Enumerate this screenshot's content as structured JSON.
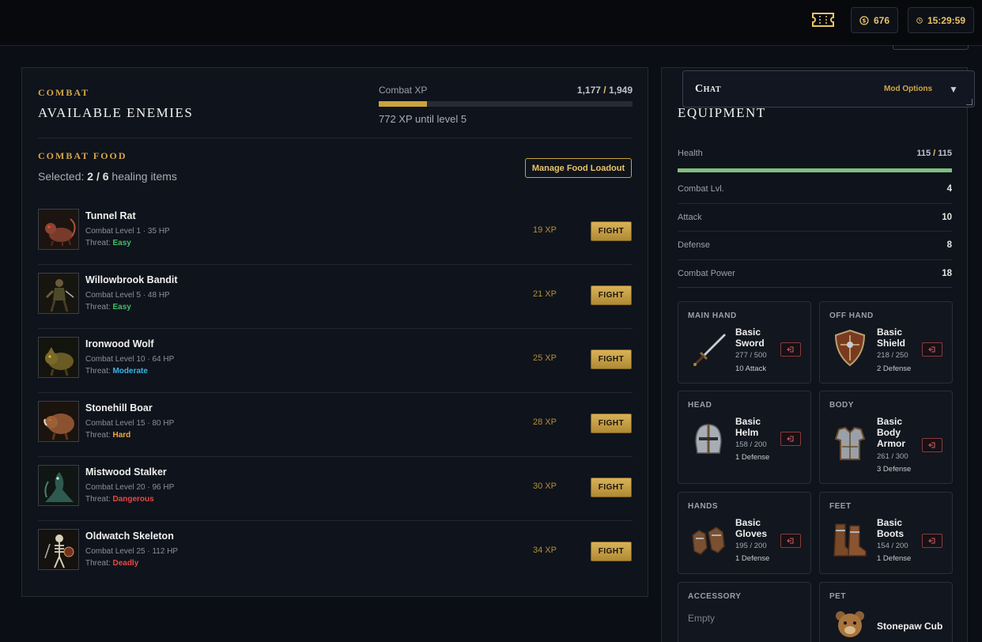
{
  "topbar": {
    "coins": "676",
    "clock": "15:29:59"
  },
  "combat": {
    "kicker": "Combat",
    "title": "Available Enemies",
    "xp_label": "Combat XP",
    "xp_current": "1,177",
    "xp_sep": " / ",
    "xp_max": "1,949",
    "xp_fraction": 0.19,
    "xp_note": "772 XP until level 5"
  },
  "food": {
    "kicker": "Combat Food",
    "selected_prefix": "Selected: ",
    "selected_value": "2 / 6",
    "selected_suffix": " healing items",
    "manage_label": "Manage Food Loadout"
  },
  "enemies": [
    {
      "name": "Tunnel Rat",
      "meta": "Combat Level 1 · 35 HP",
      "threat_label": "Threat: ",
      "threat": "Easy",
      "threat_color": "#3fbf6a",
      "xp": "19 XP",
      "fight": "FIGHT"
    },
    {
      "name": "Willowbrook Bandit",
      "meta": "Combat Level 5 · 48 HP",
      "threat_label": "Threat: ",
      "threat": "Easy",
      "threat_color": "#3fbf6a",
      "xp": "21 XP",
      "fight": "FIGHT"
    },
    {
      "name": "Ironwood Wolf",
      "meta": "Combat Level 10 · 64 HP",
      "threat_label": "Threat: ",
      "threat": "Moderate",
      "threat_color": "#3ab4e6",
      "xp": "25 XP",
      "fight": "FIGHT"
    },
    {
      "name": "Stonehill Boar",
      "meta": "Combat Level 15 · 80 HP",
      "threat_label": "Threat: ",
      "threat": "Hard",
      "threat_color": "#f0a93a",
      "xp": "28 XP",
      "fight": "FIGHT"
    },
    {
      "name": "Mistwood Stalker",
      "meta": "Combat Level 20 · 96 HP",
      "threat_label": "Threat: ",
      "threat": "Dangerous",
      "threat_color": "#e64848",
      "xp": "30 XP",
      "fight": "FIGHT"
    },
    {
      "name": "Oldwatch Skeleton",
      "meta": "Combat Level 25 · 112 HP",
      "threat_label": "Threat: ",
      "threat": "Deadly",
      "threat_color": "#e64848",
      "xp": "34 XP",
      "fight": "FIGHT"
    }
  ],
  "equipment": {
    "title": "Equipment",
    "health_label": "Health",
    "health_current": "115",
    "health_sep": " / ",
    "health_max": "115",
    "health_fraction": 1.0,
    "stats": [
      {
        "label": "Combat Lvl.",
        "value": "4"
      },
      {
        "label": "Attack",
        "value": "10"
      },
      {
        "label": "Defense",
        "value": "8"
      },
      {
        "label": "Combat Power",
        "value": "18"
      }
    ],
    "slots": {
      "main_hand": {
        "label": "MAIN HAND",
        "name": "Basic Sword",
        "durability": "277 / 500",
        "bonus": "10 Attack",
        "icon": "sword-icon"
      },
      "off_hand": {
        "label": "OFF HAND",
        "name": "Basic Shield",
        "durability": "218 / 250",
        "bonus": "2 Defense",
        "icon": "shield-icon"
      },
      "head": {
        "label": "HEAD",
        "name": "Basic Helm",
        "durability": "158 / 200",
        "bonus": "1 Defense",
        "icon": "helm-icon"
      },
      "body": {
        "label": "BODY",
        "name": "Basic Body Armor",
        "durability": "261 / 300",
        "bonus": "3 Defense",
        "icon": "armor-icon"
      },
      "hands": {
        "label": "HANDS",
        "name": "Basic Gloves",
        "durability": "195 / 200",
        "bonus": "1 Defense",
        "icon": "gloves-icon"
      },
      "feet": {
        "label": "FEET",
        "name": "Basic Boots",
        "durability": "154 / 200",
        "bonus": "1 Defense",
        "icon": "boots-icon"
      },
      "accessory": {
        "label": "ACCESSORY",
        "empty": "Empty"
      },
      "pet": {
        "label": "PET",
        "name": "Stonepaw Cub",
        "icon": "bear-cub-icon"
      }
    }
  },
  "chat": {
    "title": "Chat",
    "mod_options": "Mod Options",
    "toggle": "▼"
  },
  "colors": {
    "accent": "#d4a64a",
    "gold_button": "#c9a33e",
    "health": "#7fbf7f",
    "background": "#0b0e14"
  }
}
